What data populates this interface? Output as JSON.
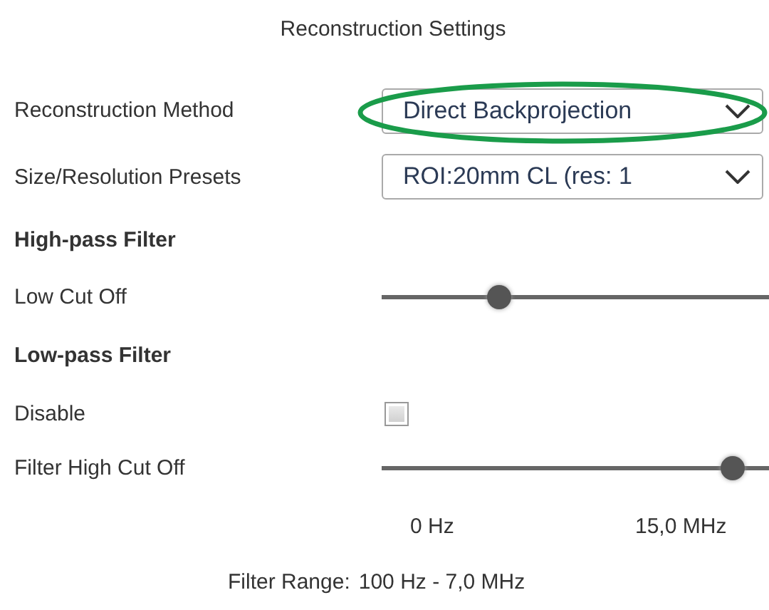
{
  "title": "Reconstruction Settings",
  "method": {
    "label": "Reconstruction Method",
    "value": "Direct Backprojection",
    "highlighted": true
  },
  "presets": {
    "label": "Size/Resolution Presets",
    "value": "ROI:20mm CL (res: 1"
  },
  "high_pass": {
    "heading": "High-pass Filter",
    "label": "Low Cut Off",
    "level": 0.29
  },
  "low_pass": {
    "heading": "Low-pass Filter",
    "disable_label": "Disable",
    "disabled": false,
    "label": "Filter High Cut Off",
    "level": 0.93
  },
  "range_labels": [
    "0 Hz",
    "15,0 MHz"
  ],
  "filter_range": {
    "label": "Filter Range:",
    "value": "100 Hz - 7,0 MHz"
  }
}
